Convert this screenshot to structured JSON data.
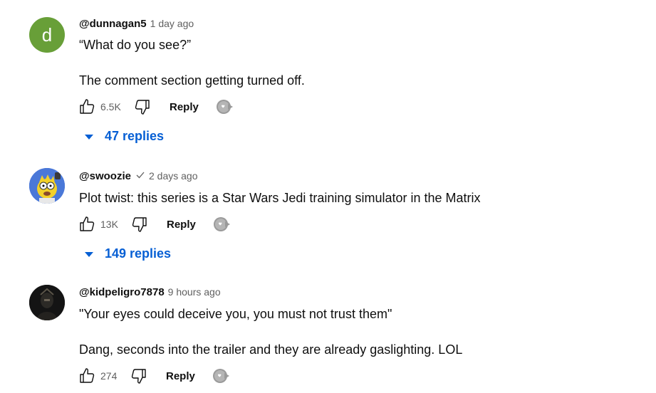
{
  "comments": [
    {
      "author": "@dunnagan5",
      "verified": false,
      "time": "1 day ago",
      "avatar_letter": "d",
      "lines": [
        "“What do you see?”",
        "The comment section getting turned off."
      ],
      "likes": "6.5K",
      "reply_label": "Reply",
      "replies_label": "47 replies"
    },
    {
      "author": "@swoozie",
      "verified": true,
      "time": "2 days ago",
      "lines": [
        "Plot twist: this series is a Star Wars Jedi training simulator in the Matrix"
      ],
      "likes": "13K",
      "reply_label": "Reply",
      "replies_label": "149 replies"
    },
    {
      "author": "@kidpeligro7878",
      "verified": false,
      "time": "9 hours ago",
      "lines": [
        "\"Your eyes could deceive you, you must not trust them\"",
        "Dang, seconds into the trailer and they are already gaslighting. LOL"
      ],
      "likes": "274",
      "reply_label": "Reply"
    }
  ],
  "icons": {
    "like": "thumbs-up-icon",
    "dislike": "thumbs-down-icon",
    "creator_heart": "creator-heart-icon",
    "expand": "caret-down-icon",
    "verified": "checkmark-icon"
  },
  "colors": {
    "link": "#065fd4",
    "secondary_text": "#606060",
    "avatar_d": "#689f38"
  }
}
